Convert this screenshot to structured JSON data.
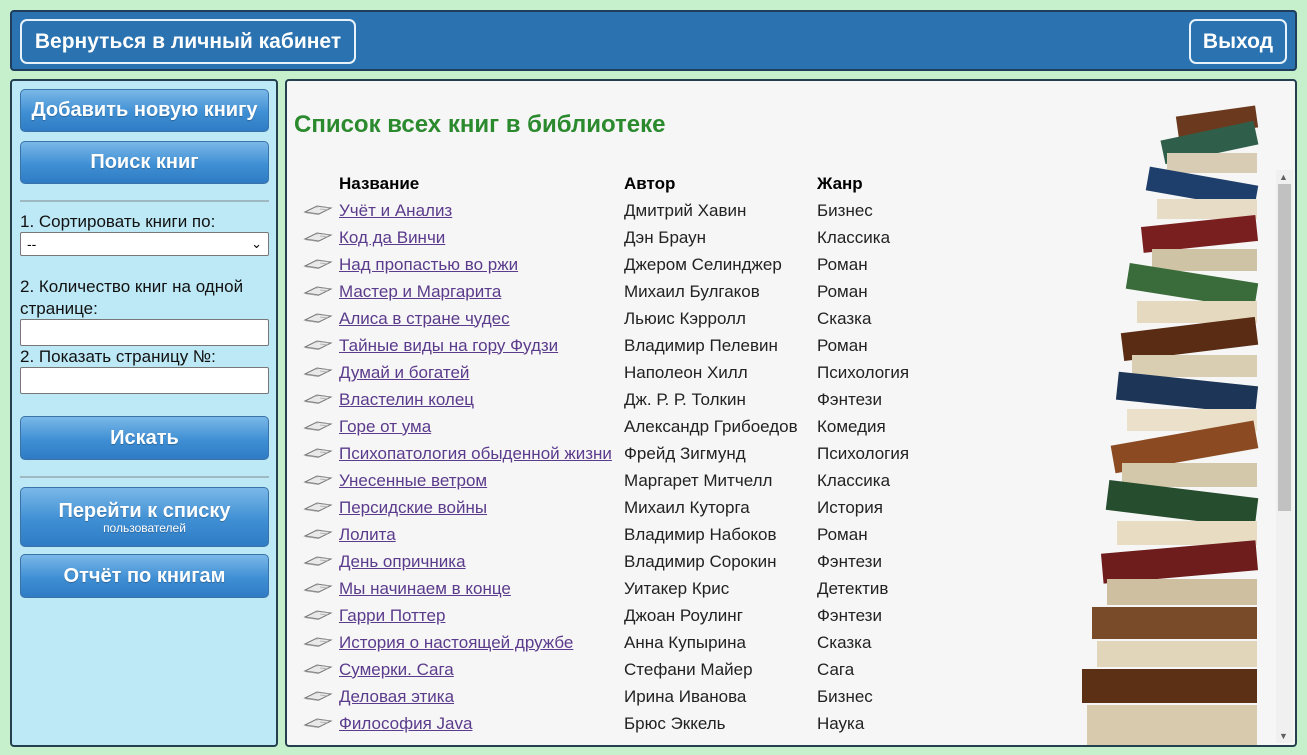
{
  "header": {
    "back_label": "Вернуться в личный кабинет",
    "exit_label": "Выход"
  },
  "sidebar": {
    "add_book": "Добавить новую книгу",
    "search_books": "Поиск книг",
    "sort_label": "1. Сортировать книги по:",
    "sort_value": "--",
    "per_page_label": "2. Количество книг на одной странице:",
    "per_page_value": "",
    "page_label": "2. Показать страницу №:",
    "page_value": "",
    "search_button": "Искать",
    "users_list_label": "Перейти к списку",
    "users_list_sub": "пользователей",
    "report_label": "Отчёт по книгам"
  },
  "main": {
    "title": "Список всех книг в библиотеке",
    "columns": [
      "Название",
      "Автор",
      "Жанр"
    ],
    "rows": [
      {
        "title": "Учёт и Анализ",
        "author": "Дмитрий Хавин",
        "genre": "Бизнес"
      },
      {
        "title": "Код да Винчи",
        "author": "Дэн Браун",
        "genre": "Классика"
      },
      {
        "title": "Над пропастью во ржи",
        "author": "Джером Селинджер",
        "genre": "Роман"
      },
      {
        "title": "Мастер и Маргарита",
        "author": "Михаил Булгаков",
        "genre": "Роман"
      },
      {
        "title": "Алиса в стране чудес",
        "author": "Льюис Кэрролл",
        "genre": "Сказка"
      },
      {
        "title": "Тайные виды на гору Фудзи",
        "author": "Владимир Пелевин",
        "genre": "Роман"
      },
      {
        "title": "Думай и богатей",
        "author": "Наполеон Хилл",
        "genre": "Психология"
      },
      {
        "title": "Властелин колец",
        "author": "Дж. Р. Р. Толкин",
        "genre": "Фэнтези"
      },
      {
        "title": "Горе от ума",
        "author": "Александр Грибоедов",
        "genre": "Комедия"
      },
      {
        "title": "Психопатология обыденной жизни",
        "author": "Фрейд Зигмунд",
        "genre": "Психология"
      },
      {
        "title": "Унесенные ветром",
        "author": "Маргарет Митчелл",
        "genre": "Классика"
      },
      {
        "title": "Персидские войны",
        "author": "Михаил Куторга",
        "genre": "История"
      },
      {
        "title": "Лолита",
        "author": "Владимир Набоков",
        "genre": "Роман"
      },
      {
        "title": "День опричника",
        "author": "Владимир Сорокин",
        "genre": "Фэнтези"
      },
      {
        "title": "Мы начинаем в конце",
        "author": "Уитакер Крис",
        "genre": "Детектив"
      },
      {
        "title": "Гарри Поттер",
        "author": "Джоан Роулинг",
        "genre": "Фэнтези"
      },
      {
        "title": "История о настоящей дружбе",
        "author": "Анна Купырина",
        "genre": "Сказка"
      },
      {
        "title": "Сумерки. Сага",
        "author": "Стефани Майер",
        "genre": "Сага"
      },
      {
        "title": "Деловая этика",
        "author": "Ирина Иванова",
        "genre": "Бизнес"
      },
      {
        "title": "Философия Java",
        "author": "Брюс Эккель",
        "genre": "Наука"
      }
    ]
  },
  "colors": {
    "page_bg": "#c6f0cb",
    "header_bg": "#2a72b0",
    "sidebar_bg": "#bde8f5",
    "title_green": "#2c8a2e",
    "link": "#5b3b8c"
  },
  "icons": {
    "row_icon": "open-book-icon",
    "select_chevron": "chevron-down-icon",
    "decoration": "book-stack-image"
  }
}
